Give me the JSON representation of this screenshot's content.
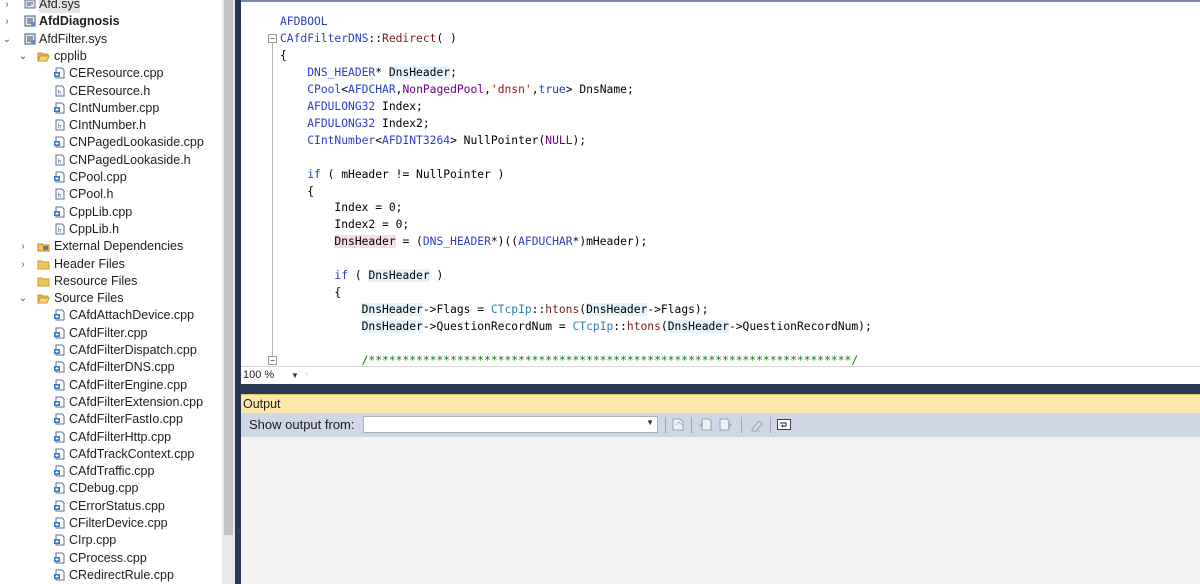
{
  "explorer": {
    "items": [
      {
        "label": "Afd.sys",
        "expander": "›",
        "icon": "reference-icon",
        "bold": false,
        "selected": true
      },
      {
        "label": "AfdDiagnosis",
        "expander": "›",
        "icon": "project-icon",
        "bold": true
      },
      {
        "label": "AfdFilter.sys",
        "expander": "⌄",
        "icon": "project-icon",
        "bold": false
      },
      {
        "label": "cpplib",
        "expander": "⌄",
        "icon": "folder-open-icon"
      },
      {
        "label": "CEResource.cpp",
        "icon": "cpp-file-icon"
      },
      {
        "label": "CEResource.h",
        "icon": "header-file-icon"
      },
      {
        "label": "CIntNumber.cpp",
        "icon": "cpp-file-icon"
      },
      {
        "label": "CIntNumber.h",
        "icon": "header-file-icon"
      },
      {
        "label": "CNPagedLookaside.cpp",
        "icon": "cpp-file-icon"
      },
      {
        "label": "CNPagedLookaside.h",
        "icon": "header-file-icon"
      },
      {
        "label": "CPool.cpp",
        "icon": "cpp-file-icon"
      },
      {
        "label": "CPool.h",
        "icon": "header-file-icon"
      },
      {
        "label": "CppLib.cpp",
        "icon": "cpp-file-icon"
      },
      {
        "label": "CppLib.h",
        "icon": "header-file-icon"
      },
      {
        "label": "External Dependencies",
        "expander": "›",
        "icon": "dependencies-icon"
      },
      {
        "label": "Header Files",
        "expander": "›",
        "icon": "folder-icon"
      },
      {
        "label": "Resource Files",
        "icon": "folder-icon"
      },
      {
        "label": "Source Files",
        "expander": "⌄",
        "icon": "folder-open-icon"
      },
      {
        "label": "CAfdAttachDevice.cpp",
        "icon": "cpp-file-icon"
      },
      {
        "label": "CAfdFilter.cpp",
        "icon": "cpp-file-icon"
      },
      {
        "label": "CAfdFilterDispatch.cpp",
        "icon": "cpp-file-icon"
      },
      {
        "label": "CAfdFilterDNS.cpp",
        "icon": "cpp-file-icon"
      },
      {
        "label": "CAfdFilterEngine.cpp",
        "icon": "cpp-file-icon"
      },
      {
        "label": "CAfdFilterExtension.cpp",
        "icon": "cpp-file-icon"
      },
      {
        "label": "CAfdFilterFastIo.cpp",
        "icon": "cpp-file-icon"
      },
      {
        "label": "CAfdFilterHttp.cpp",
        "icon": "cpp-file-icon"
      },
      {
        "label": "CAfdTrackContext.cpp",
        "icon": "cpp-file-icon"
      },
      {
        "label": "CAfdTraffic.cpp",
        "icon": "cpp-file-icon"
      },
      {
        "label": "CDebug.cpp",
        "icon": "cpp-file-icon"
      },
      {
        "label": "CErrorStatus.cpp",
        "icon": "cpp-file-icon"
      },
      {
        "label": "CFilterDevice.cpp",
        "icon": "cpp-file-icon"
      },
      {
        "label": "CIrp.cpp",
        "icon": "cpp-file-icon"
      },
      {
        "label": "CProcess.cpp",
        "icon": "cpp-file-icon"
      },
      {
        "label": "CRedirectRule.cpp",
        "icon": "cpp-file-icon"
      }
    ]
  },
  "editor": {
    "lines": [
      [
        {
          "t": "AFDBOOL",
          "c": "type"
        }
      ],
      [
        {
          "t": "CAfdFilterDNS",
          "c": "type"
        },
        {
          "t": "::",
          "c": ""
        },
        {
          "t": "Redirect",
          "c": "func"
        },
        {
          "t": "( )",
          "c": ""
        }
      ],
      [
        {
          "t": "{",
          "c": ""
        }
      ],
      [
        {
          "t": "    ",
          "c": ""
        },
        {
          "t": "DNS_HEADER",
          "c": "type"
        },
        {
          "t": "* ",
          "c": ""
        },
        {
          "t": "DnsHeader",
          "c": "var"
        },
        {
          "t": ";",
          "c": ""
        }
      ],
      [
        {
          "t": "    ",
          "c": ""
        },
        {
          "t": "CPool",
          "c": "type"
        },
        {
          "t": "<",
          "c": ""
        },
        {
          "t": "AFDCHAR",
          "c": "type"
        },
        {
          "t": ",",
          "c": ""
        },
        {
          "t": "NonPagedPool",
          "c": "macro"
        },
        {
          "t": ",",
          "c": ""
        },
        {
          "t": "'dnsn'",
          "c": "str"
        },
        {
          "t": ",",
          "c": ""
        },
        {
          "t": "true",
          "c": "kw"
        },
        {
          "t": "> DnsName;",
          "c": ""
        }
      ],
      [
        {
          "t": "    ",
          "c": ""
        },
        {
          "t": "AFDULONG32",
          "c": "type"
        },
        {
          "t": " Index;",
          "c": ""
        }
      ],
      [
        {
          "t": "    ",
          "c": ""
        },
        {
          "t": "AFDULONG32",
          "c": "type"
        },
        {
          "t": " Index2;",
          "c": ""
        }
      ],
      [
        {
          "t": "    ",
          "c": ""
        },
        {
          "t": "CIntNumber",
          "c": "type"
        },
        {
          "t": "<",
          "c": ""
        },
        {
          "t": "AFDINT3264",
          "c": "type"
        },
        {
          "t": "> NullPointer(",
          "c": ""
        },
        {
          "t": "NULL",
          "c": "macro"
        },
        {
          "t": ");",
          "c": ""
        }
      ],
      [
        {
          "t": "",
          "c": ""
        }
      ],
      [
        {
          "t": "    ",
          "c": ""
        },
        {
          "t": "if",
          "c": "kw"
        },
        {
          "t": " ( mHeader != NullPointer )",
          "c": ""
        }
      ],
      [
        {
          "t": "    {",
          "c": ""
        }
      ],
      [
        {
          "t": "        Index = 0;",
          "c": ""
        }
      ],
      [
        {
          "t": "        Index2 = 0;",
          "c": ""
        }
      ],
      [
        {
          "t": "        ",
          "c": ""
        },
        {
          "t": "DnsHeader",
          "c": "varsel"
        },
        {
          "t": " = (",
          "c": ""
        },
        {
          "t": "DNS_HEADER",
          "c": "type"
        },
        {
          "t": "*)((",
          "c": ""
        },
        {
          "t": "AFDUCHAR",
          "c": "type"
        },
        {
          "t": "*)mHeader);",
          "c": ""
        }
      ],
      [
        {
          "t": "",
          "c": ""
        }
      ],
      [
        {
          "t": "        ",
          "c": ""
        },
        {
          "t": "if",
          "c": "kw"
        },
        {
          "t": " ( ",
          "c": ""
        },
        {
          "t": "DnsHeader",
          "c": "var"
        },
        {
          "t": " )",
          "c": ""
        }
      ],
      [
        {
          "t": "        {",
          "c": ""
        }
      ],
      [
        {
          "t": "            ",
          "c": ""
        },
        {
          "t": "DnsHeader",
          "c": "var"
        },
        {
          "t": "->Flags = ",
          "c": ""
        },
        {
          "t": "CTcpIp",
          "c": "cls"
        },
        {
          "t": "::",
          "c": ""
        },
        {
          "t": "htons",
          "c": "func"
        },
        {
          "t": "(",
          "c": ""
        },
        {
          "t": "DnsHeader",
          "c": "var"
        },
        {
          "t": "->Flags);",
          "c": ""
        }
      ],
      [
        {
          "t": "            ",
          "c": ""
        },
        {
          "t": "DnsHeader",
          "c": "var"
        },
        {
          "t": "->QuestionRecordNum = ",
          "c": ""
        },
        {
          "t": "CTcpIp",
          "c": "cls"
        },
        {
          "t": "::",
          "c": ""
        },
        {
          "t": "htons",
          "c": "func"
        },
        {
          "t": "(",
          "c": ""
        },
        {
          "t": "DnsHeader",
          "c": "var"
        },
        {
          "t": "->QuestionRecordNum);",
          "c": ""
        }
      ],
      [
        {
          "t": "",
          "c": ""
        }
      ],
      [
        {
          "t": "            ",
          "c": ""
        },
        {
          "t": "/***********************************************************************/",
          "c": "cmt"
        }
      ]
    ],
    "zoom": "100 %"
  },
  "output": {
    "title": "Output",
    "show_label": "Show output from:",
    "selected_source": ""
  },
  "colors": {
    "frame": "#293955",
    "output_title": "#fde7a9",
    "toolbar": "#cfd6e5"
  }
}
